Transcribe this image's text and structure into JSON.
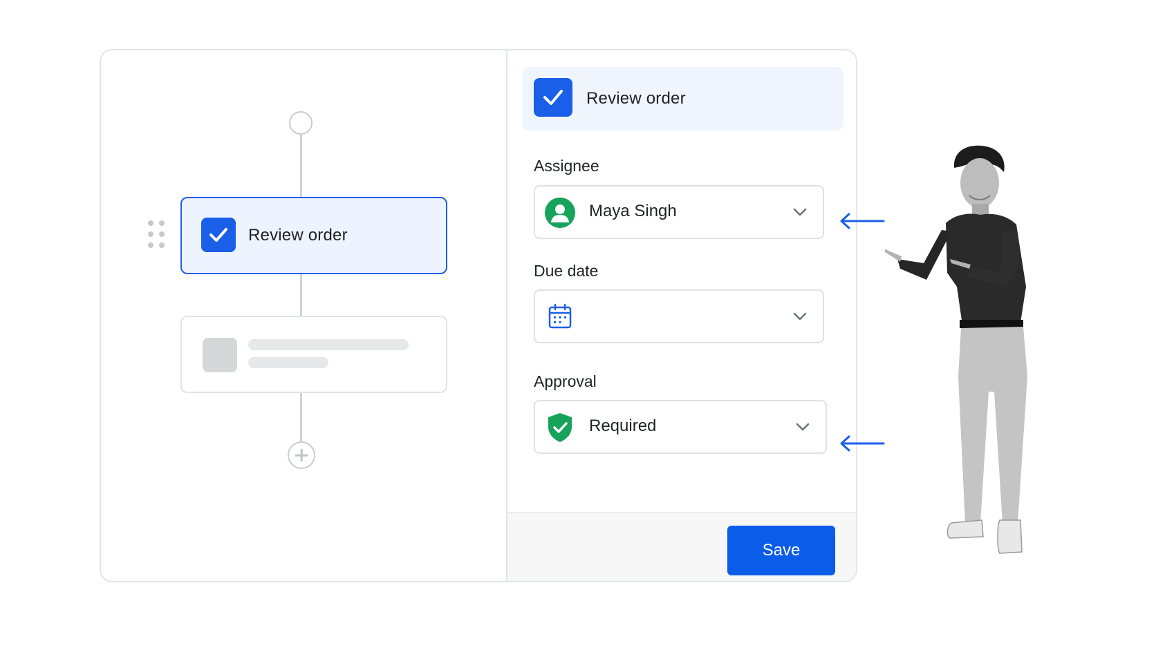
{
  "workflow": {
    "steps": [
      {
        "title": "Review order",
        "state": "selected",
        "icon": "check-icon"
      },
      {
        "title": "",
        "state": "placeholder"
      }
    ],
    "add_step_icon": "plus-icon"
  },
  "panel": {
    "header": {
      "title": "Review order",
      "icon": "check-icon"
    },
    "fields": {
      "assignee": {
        "label": "Assignee",
        "value": "Maya Singh",
        "icon": "user-avatar-icon"
      },
      "due_date": {
        "label": "Due date",
        "value": "",
        "icon": "calendar-icon"
      },
      "approval": {
        "label": "Approval",
        "value": "Required",
        "icon": "shield-check-icon"
      }
    },
    "save_label": "Save"
  },
  "colors": {
    "accent": "#1a5fe8",
    "selected_bg": "#eef4ff",
    "success": "#16a35a",
    "arrow": "#1a5fe8"
  }
}
